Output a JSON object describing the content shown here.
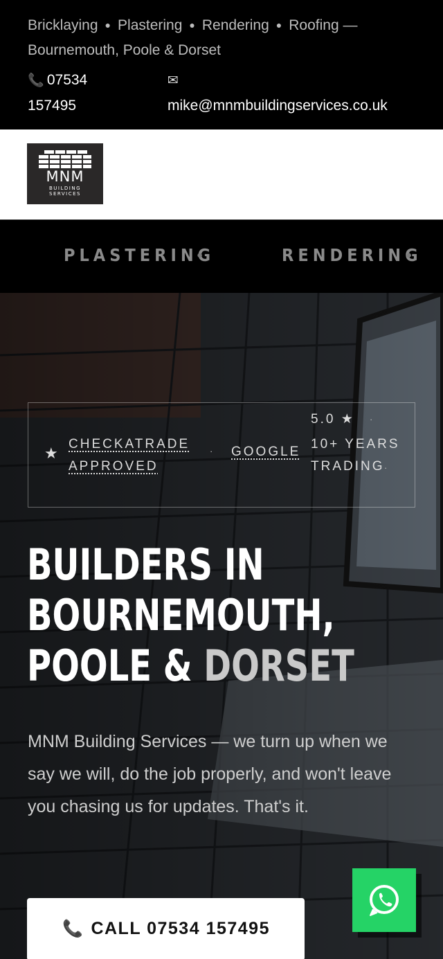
{
  "topbar": {
    "services": [
      "Bricklaying",
      "Plastering",
      "Rendering",
      "Roofing"
    ],
    "location_suffix": "— Bournemouth, Poole & Dorset",
    "phone_icon": "phone-icon",
    "phone": "07534 157495",
    "email_icon": "envelope-icon",
    "email": "mike@mnmbuildingservices.co.uk"
  },
  "header": {
    "logo_title": "MNM",
    "logo_sub_1": "BUILDING",
    "logo_sub_2": "SERVICES"
  },
  "ticker": {
    "items": [
      "PLASTERING",
      "RENDERING"
    ]
  },
  "hero": {
    "badges": {
      "checkatrade": "CHECKATRADE APPROVED",
      "google": "GOOGLE",
      "rating": "5.0 ★",
      "years": "10+ YEARS TRADING"
    },
    "title_line1": "BUILDERS IN",
    "title_line2": "BOURNEMOUTH,",
    "title_line3_a": "POOLE & ",
    "title_line3_b": "DORSET",
    "lede": "MNM Building Services — we turn up when we say we will, do the job properly, and won't leave you chasing us for updates. That's it.",
    "call_label": "CALL 07534 157495"
  },
  "colors": {
    "topbar_bg": "#000000",
    "header_bg": "#ffffff",
    "whatsapp": "#25d366",
    "accent_title": "#c9c9c9"
  },
  "floating": {
    "whatsapp_icon": "whatsapp-icon"
  }
}
